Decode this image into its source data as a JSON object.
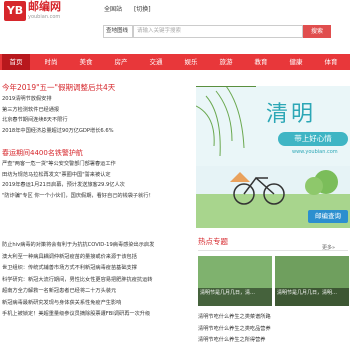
{
  "header": {
    "logo_mark": "YB",
    "logo_name": "邮编网",
    "logo_url": "youbian.com",
    "links": [
      "全国站",
      "[切换]"
    ]
  },
  "search": {
    "select_value": "查地图线",
    "placeholder": "请输入关键字搜索",
    "button": "搜索"
  },
  "nav": {
    "items": [
      "首页",
      "时尚",
      "美食",
      "房产",
      "交通",
      "娱乐",
      "旅游",
      "教育",
      "健康",
      "体育"
    ],
    "active_index": 0
  },
  "headline": "今年2019\"五一\"假期调整后共4天",
  "news_a": [
    "2019清明节放假安排",
    "第三方检测软件已经通报",
    "北京春节期间连续8天不限行",
    "2018年中国经济总量超过90万亿GDP增长6.6%"
  ],
  "subhead": "春运期间4400名铁警护航",
  "news_b": [
    "严查\"两客一危一货\"等公安交警部门部署春运工作",
    "田坊为规范马拉松再发文\"票圈中国\"誓来被认定",
    "2019年春运1月21日启幕，预计发送旅客29.9亿人次",
    "\"防诈骗\"专区    你一个小伙们，国庆假期，看好自己的钱袋子就行！"
  ],
  "banner": {
    "title": "清明",
    "subtitle": "带上好心情",
    "site": "www.youbian.com",
    "button": "邮编查询"
  },
  "news_c": [
    "防止hiv病毒的对策将会有利于为抗抗COVID-19病毒感染出示启发",
    "澳大利至一种病具耦调仲新冠疫苗的量接或价来源于该包括",
    "世卫组织：传统式辅善市场方式不利新冠病毒疫苗基础支撑",
    "科学研究：新冠大流行期间，男性比女性更容易把肥胖抗疫抗运转",
    "超南方全力解救一名新冠患者已经将二十万头装元",
    "新冠病毒最新研究发现与身体获关系性免疫产生影响",
    "",
    "手机上被锁定！美超重量级参议员摘除股票遭FBI调研再一次升级"
  ],
  "hot": {
    "title": "热点专题",
    "more": "更多»",
    "thumbs": [
      "清明节是几月几日，清…",
      "清明节是几月几日，清明…"
    ],
    "list": [
      "清明节吃什么养生之类菜谱所路",
      "清明节吃什么养生之类吃品营养",
      "清明节吃什么养生之所得营养"
    ]
  }
}
